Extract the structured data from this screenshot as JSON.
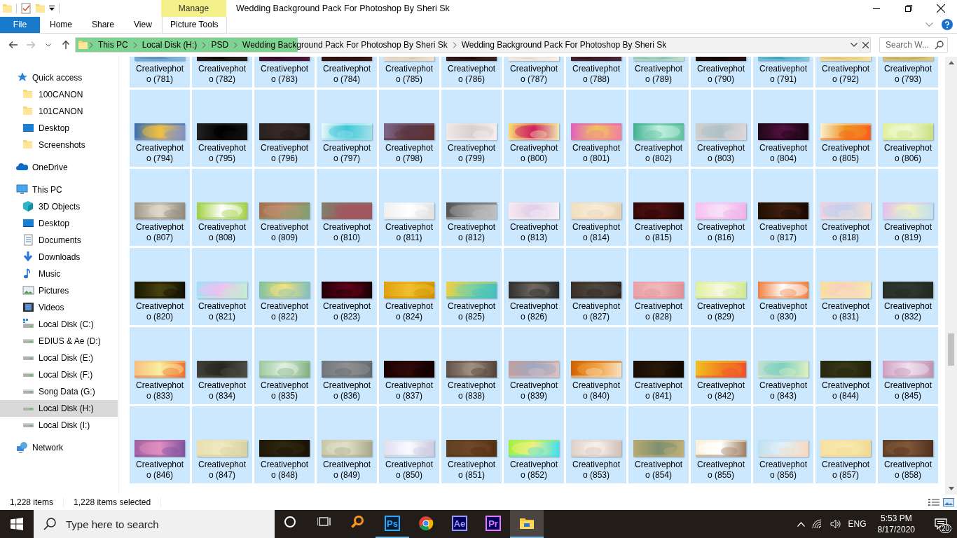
{
  "window": {
    "title": "Wedding Background Pack For Photoshop By Sheri Sk",
    "context_group": "Manage"
  },
  "ribbon": {
    "tabs": [
      {
        "label": "File",
        "kind": "file",
        "selected": false
      },
      {
        "label": "Home",
        "kind": "tab",
        "selected": false
      },
      {
        "label": "Share",
        "kind": "tab",
        "selected": false
      },
      {
        "label": "View",
        "kind": "tab",
        "selected": false
      },
      {
        "label": "Picture Tools",
        "kind": "contextual",
        "selected": false
      }
    ]
  },
  "address_bar": {
    "breadcrumbs": [
      "This PC",
      "Local Disk (H:)",
      "PSD",
      "Wedding Background Pack For Photoshop By Sheri Sk",
      "Wedding Background Pack For Photoshop By Sheri Sk"
    ],
    "progress": {
      "level": 0.283
    }
  },
  "search": {
    "placeholder": "Search W..."
  },
  "sidebar": {
    "items": [
      {
        "label": "Quick access",
        "kind": "star",
        "selected": false,
        "children": [
          {
            "label": "100CANON",
            "kind": "folder",
            "selected": false
          },
          {
            "label": "101CANON",
            "kind": "folder",
            "selected": false
          },
          {
            "label": "Desktop",
            "kind": "desktop",
            "selected": false
          },
          {
            "label": "Screenshots",
            "kind": "folder",
            "selected": false
          }
        ]
      },
      {
        "label": "OneDrive",
        "kind": "cloud",
        "selected": false
      },
      {
        "label": "This PC",
        "kind": "pc",
        "selected": false,
        "children": [
          {
            "label": "3D Objects",
            "kind": "cube",
            "selected": false
          },
          {
            "label": "Desktop",
            "kind": "desktop",
            "selected": false
          },
          {
            "label": "Documents",
            "kind": "document",
            "selected": false
          },
          {
            "label": "Downloads",
            "kind": "download",
            "selected": false
          },
          {
            "label": "Music",
            "kind": "music",
            "selected": false
          },
          {
            "label": "Pictures",
            "kind": "pictures",
            "selected": false
          },
          {
            "label": "Videos",
            "kind": "video",
            "selected": false
          },
          {
            "label": "Local Disk (C:)",
            "kind": "system-drive",
            "selected": false
          },
          {
            "label": "EDIUS & Ae (D:)",
            "kind": "drive",
            "selected": false
          },
          {
            "label": "Local Disk (E:)",
            "kind": "drive",
            "selected": false
          },
          {
            "label": "Local Disk (F:)",
            "kind": "drive",
            "selected": false
          },
          {
            "label": "Song Data (G:)",
            "kind": "drive",
            "selected": false
          },
          {
            "label": "Local Disk (H:)",
            "kind": "drive",
            "selected": true
          },
          {
            "label": "Local Disk (I:)",
            "kind": "drive",
            "selected": false
          }
        ]
      },
      {
        "label": "Network",
        "kind": "network",
        "selected": false
      }
    ]
  },
  "files": {
    "items": [
      {
        "name": "Creativephoto (781)",
        "selected": true
      },
      {
        "name": "Creativephoto (782)",
        "selected": true
      },
      {
        "name": "Creativephoto (783)",
        "selected": true
      },
      {
        "name": "Creativephoto (784)",
        "selected": true
      },
      {
        "name": "Creativephoto (785)",
        "selected": true
      },
      {
        "name": "Creativephoto (786)",
        "selected": true
      },
      {
        "name": "Creativephoto (787)",
        "selected": true
      },
      {
        "name": "Creativephoto (788)",
        "selected": true
      },
      {
        "name": "Creativephoto (789)",
        "selected": true
      },
      {
        "name": "Creativephoto (790)",
        "selected": true
      },
      {
        "name": "Creativephoto (791)",
        "selected": true
      },
      {
        "name": "Creativephoto (792)",
        "selected": true
      },
      {
        "name": "Creativephoto (793)",
        "selected": true
      },
      {
        "name": "Creativephoto (794)",
        "selected": true
      },
      {
        "name": "Creativephoto (795)",
        "selected": true
      },
      {
        "name": "Creativephoto (796)",
        "selected": true
      },
      {
        "name": "Creativephoto (797)",
        "selected": true
      },
      {
        "name": "Creativephoto (798)",
        "selected": true
      },
      {
        "name": "Creativephoto (799)",
        "selected": true
      },
      {
        "name": "Creativephoto (800)",
        "selected": true
      },
      {
        "name": "Creativephoto (801)",
        "selected": true
      },
      {
        "name": "Creativephoto (802)",
        "selected": true
      },
      {
        "name": "Creativephoto (803)",
        "selected": true
      },
      {
        "name": "Creativephoto (804)",
        "selected": true
      },
      {
        "name": "Creativephoto (805)",
        "selected": true
      },
      {
        "name": "Creativephoto (806)",
        "selected": true
      },
      {
        "name": "Creativephoto (807)",
        "selected": true
      },
      {
        "name": "Creativephoto (808)",
        "selected": true
      },
      {
        "name": "Creativephoto (809)",
        "selected": true
      },
      {
        "name": "Creativephoto (810)",
        "selected": true
      },
      {
        "name": "Creativephoto (811)",
        "selected": true
      },
      {
        "name": "Creativephoto (812)",
        "selected": true
      },
      {
        "name": "Creativephoto (813)",
        "selected": true
      },
      {
        "name": "Creativephoto (814)",
        "selected": true
      },
      {
        "name": "Creativephoto (815)",
        "selected": true
      },
      {
        "name": "Creativephoto (816)",
        "selected": true
      },
      {
        "name": "Creativephoto (817)",
        "selected": true
      },
      {
        "name": "Creativephoto (818)",
        "selected": true
      },
      {
        "name": "Creativephoto (819)",
        "selected": true
      },
      {
        "name": "Creativephoto (820)",
        "selected": true
      },
      {
        "name": "Creativephoto (821)",
        "selected": true
      },
      {
        "name": "Creativephoto (822)",
        "selected": true
      },
      {
        "name": "Creativephoto (823)",
        "selected": true
      },
      {
        "name": "Creativephoto (824)",
        "selected": true
      },
      {
        "name": "Creativephoto (825)",
        "selected": true
      },
      {
        "name": "Creativephoto (826)",
        "selected": true
      },
      {
        "name": "Creativephoto (827)",
        "selected": true
      },
      {
        "name": "Creativephoto (828)",
        "selected": true
      },
      {
        "name": "Creativephoto (829)",
        "selected": true
      },
      {
        "name": "Creativephoto (830)",
        "selected": true
      },
      {
        "name": "Creativephoto (831)",
        "selected": true
      },
      {
        "name": "Creativephoto (832)",
        "selected": true
      },
      {
        "name": "Creativephoto (833)",
        "selected": true
      },
      {
        "name": "Creativephoto (834)",
        "selected": true
      },
      {
        "name": "Creativephoto (835)",
        "selected": true
      },
      {
        "name": "Creativephoto (836)",
        "selected": true
      },
      {
        "name": "Creativephoto (837)",
        "selected": true
      },
      {
        "name": "Creativephoto (838)",
        "selected": true
      },
      {
        "name": "Creativephoto (839)",
        "selected": true
      },
      {
        "name": "Creativephoto (840)",
        "selected": true
      },
      {
        "name": "Creativephoto (841)",
        "selected": true
      },
      {
        "name": "Creativephoto (842)",
        "selected": true
      },
      {
        "name": "Creativephoto (843)",
        "selected": true
      },
      {
        "name": "Creativephoto (844)",
        "selected": true
      },
      {
        "name": "Creativephoto (845)",
        "selected": true
      },
      {
        "name": "Creativephoto (846)",
        "selected": true
      },
      {
        "name": "Creativephoto (847)",
        "selected": true
      },
      {
        "name": "Creativephoto (848)",
        "selected": true
      },
      {
        "name": "Creativephoto (849)",
        "selected": true
      },
      {
        "name": "Creativephoto (850)",
        "selected": true
      },
      {
        "name": "Creativephoto (851)",
        "selected": true
      },
      {
        "name": "Creativephoto (852)",
        "selected": true
      },
      {
        "name": "Creativephoto (853)",
        "selected": true
      },
      {
        "name": "Creativephoto (854)",
        "selected": true
      },
      {
        "name": "Creativephoto (855)",
        "selected": true
      },
      {
        "name": "Creativephoto (856)",
        "selected": true
      },
      {
        "name": "Creativephoto (857)",
        "selected": true
      },
      {
        "name": "Creativephoto (858)",
        "selected": true
      }
    ]
  },
  "status_bar": {
    "item_count": "1,228 items",
    "selection": "1,228 items selected"
  },
  "taskbar": {
    "search_placeholder": "Type here to search",
    "apps": [
      {
        "kind": "cortana",
        "running": false,
        "selected": false
      },
      {
        "kind": "task-view",
        "running": false,
        "selected": false
      },
      {
        "kind": "magnifier",
        "running": false,
        "selected": false
      },
      {
        "kind": "ps",
        "label": "Ps",
        "running": true,
        "selected": false
      },
      {
        "kind": "chrome",
        "running": false,
        "selected": false
      },
      {
        "kind": "ae",
        "label": "Ae",
        "running": false,
        "selected": false
      },
      {
        "kind": "pr",
        "label": "Pr",
        "running": false,
        "selected": false
      },
      {
        "kind": "explorer",
        "running": true,
        "selected": true
      }
    ],
    "tray": {
      "language": "ENG",
      "time": "5:53 PM",
      "date": "8/17/2020",
      "notifications": "20"
    }
  }
}
